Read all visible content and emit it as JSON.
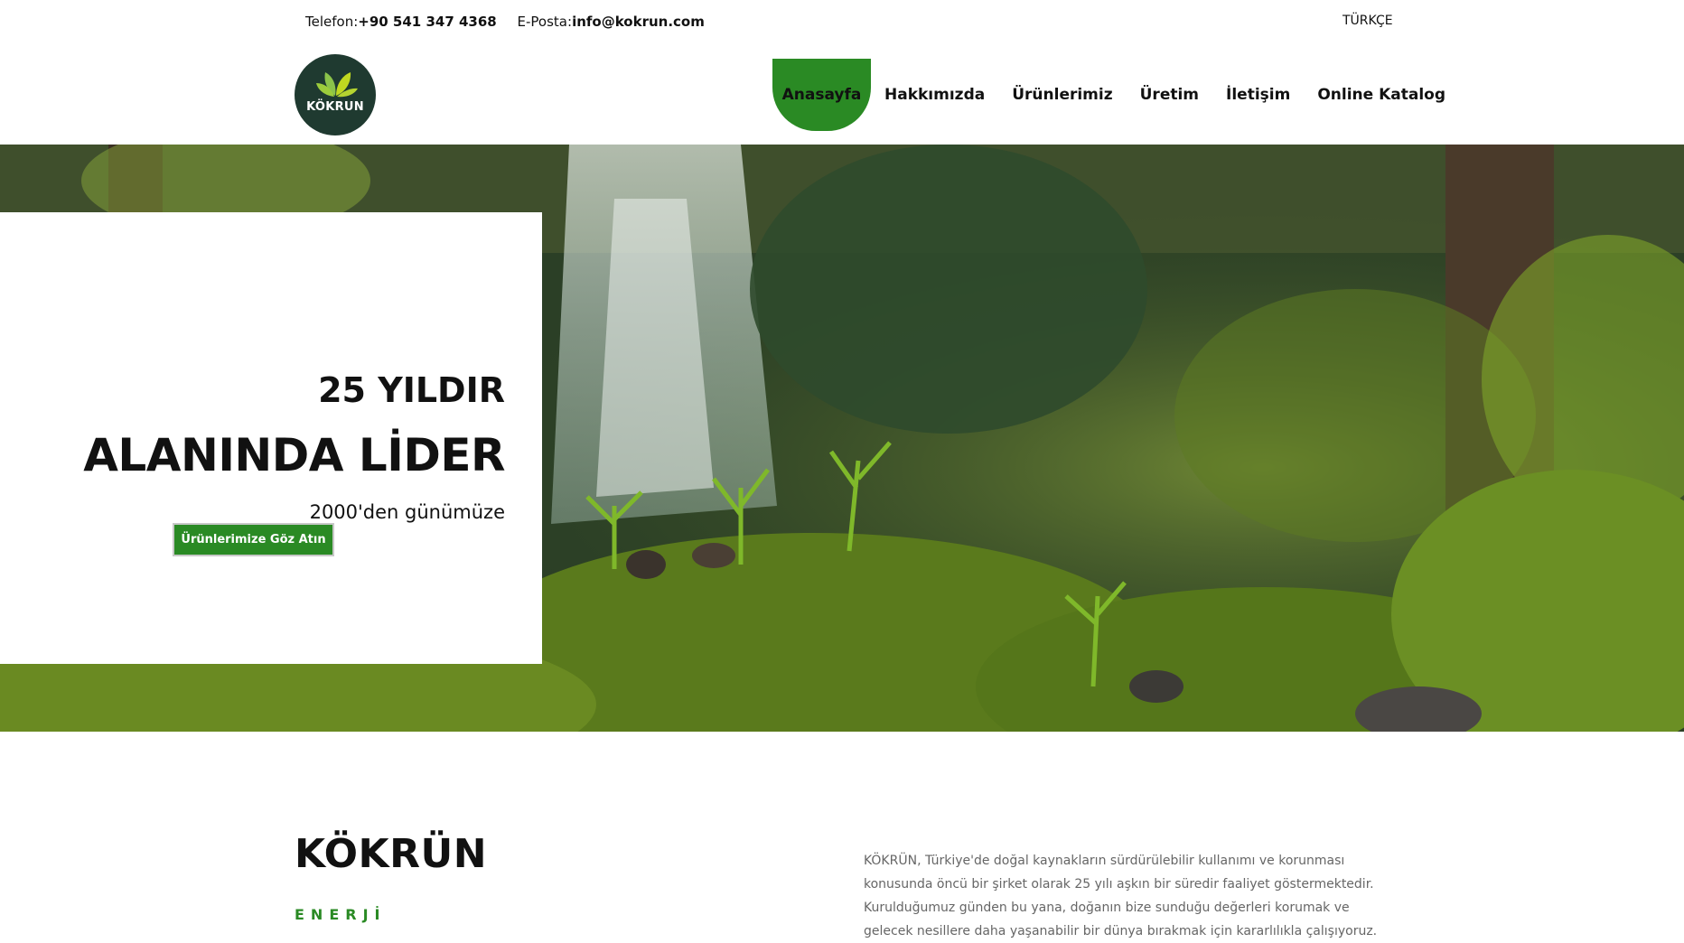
{
  "topbar": {
    "phone_label": "Telefon:",
    "phone_value": "+90 541 347 4368",
    "email_label": "E-Posta:",
    "email_value": "info@kokrun.com",
    "language": "TÜRKÇE"
  },
  "logo": {
    "text": "KÖKRUN"
  },
  "nav": {
    "items": [
      {
        "label": "Anasayfa"
      },
      {
        "label": "Hakkımızda"
      },
      {
        "label": "Ürünlerimiz"
      },
      {
        "label": "Üretim"
      },
      {
        "label": "İletişim"
      },
      {
        "label": "Online Katalog"
      }
    ],
    "active_color": "#2a8a24"
  },
  "hero": {
    "line1": "25 YILDIR",
    "line2": "ALANINDA LİDER",
    "line3": "2000'den günümüze",
    "button": "Ürünlerimize Göz Atın"
  },
  "about": {
    "title": "KÖKRÜN",
    "subtitle": "ENERJİ",
    "text": "KÖKRÜN, Türkiye'de doğal kaynakların sürdürülebilir kullanımı ve korunması konusunda öncü bir şirket olarak 25 yılı aşkın bir süredir faaliyet göstermektedir. Kurulduğumuz günden bu yana, doğanın bize sunduğu değerleri korumak ve gelecek nesillere daha yaşanabilir bir dünya bırakmak için kararlılıkla çalışıyoruz."
  },
  "colors": {
    "brand_green": "#2a8a24",
    "logo_bg": "#1f3a30"
  }
}
